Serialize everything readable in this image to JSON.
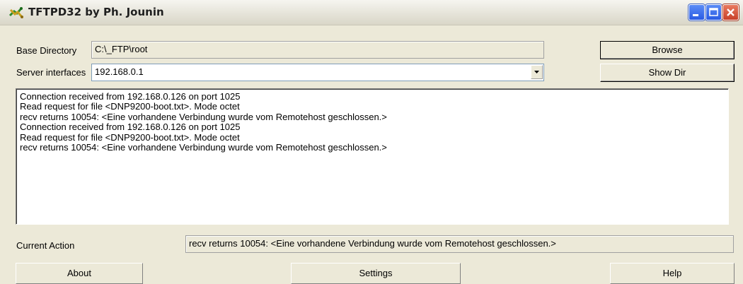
{
  "window": {
    "title": "TFTPD32 by Ph. Jounin",
    "controls": {
      "minimize": "minimize",
      "maximize": "maximize",
      "close": "close"
    }
  },
  "base_directory": {
    "label": "Base Directory",
    "value": "C:\\_FTP\\root"
  },
  "server_interfaces": {
    "label": "Server interfaces",
    "value": "192.168.0.1"
  },
  "buttons": {
    "browse": "Browse",
    "show_dir": "Show Dir",
    "about": "About",
    "settings": "Settings",
    "help": "Help"
  },
  "log": {
    "lines": [
      "Connection received from 192.168.0.126 on port 1025",
      "Read request for file <DNP9200-boot.txt>. Mode octet",
      "recv returns 10054: <Eine vorhandene Verbindung wurde vom Remotehost geschlossen.>",
      "Connection received from 192.168.0.126 on port 1025",
      "Read request for file <DNP9200-boot.txt>. Mode octet",
      "recv returns 10054: <Eine vorhandene Verbindung wurde vom Remotehost geschlossen.>"
    ]
  },
  "current_action": {
    "label": "Current Action",
    "value": "recv returns 10054: <Eine vorhandene Verbindung wurde vom Remotehost geschlossen.>"
  },
  "icons": {
    "app": "tftpd-app-icon",
    "minimize": "minimize-icon",
    "maximize": "maximize-icon",
    "close": "close-icon",
    "dropdown": "chevron-down-icon"
  }
}
